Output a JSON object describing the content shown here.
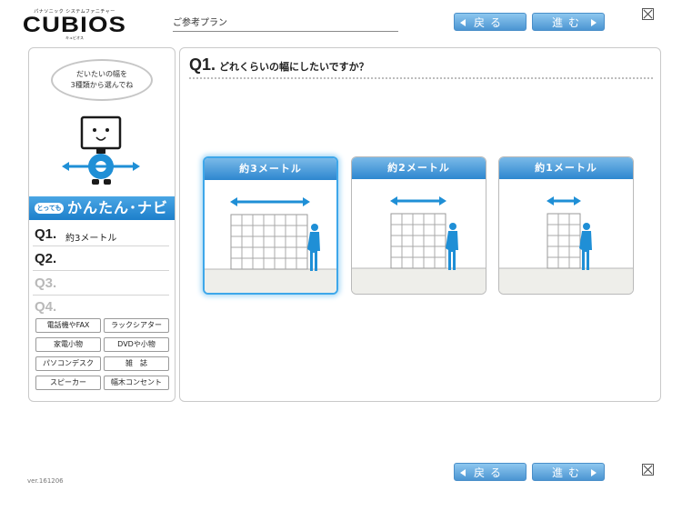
{
  "header": {
    "logo_tagline": "パナソニック システムファニチャー",
    "logo_name": "CUBIOS",
    "logo_kana": "キュビオス",
    "plan_label": "ご参考プラン",
    "back_label": "戻る",
    "next_label": "進む"
  },
  "sidebar": {
    "bubble_line1": "だいたいの幅を",
    "bubble_line2": "3種類から選んでね",
    "navi_pill": "とっても",
    "navi_title": "かんたん･ナビ",
    "questions": [
      {
        "label": "Q1.",
        "answer": "約3メートル"
      },
      {
        "label": "Q2.",
        "answer": ""
      },
      {
        "label": "Q3.",
        "answer": ""
      },
      {
        "label": "Q4.",
        "answer": ""
      }
    ],
    "options": [
      "電話機やFAX",
      "ラックシアター",
      "家電小物",
      "DVDや小物",
      "パソコンデスク",
      "雑　誌",
      "スピーカー",
      "幅木コンセント"
    ]
  },
  "main": {
    "question_number": "Q1.",
    "question_text": "どれくらいの幅にしたいですか？",
    "cards": [
      {
        "label": "約3メートル",
        "selected": true
      },
      {
        "label": "約2メートル",
        "selected": false
      },
      {
        "label": "約1メートル",
        "selected": false
      }
    ]
  },
  "footer": {
    "version": "ver.161206",
    "back_label": "戻る",
    "next_label": "進む"
  },
  "colors": {
    "accent": "#2d87cf",
    "selected_glow": "#3ea7ea",
    "figure_blue": "#1f8fd6"
  }
}
